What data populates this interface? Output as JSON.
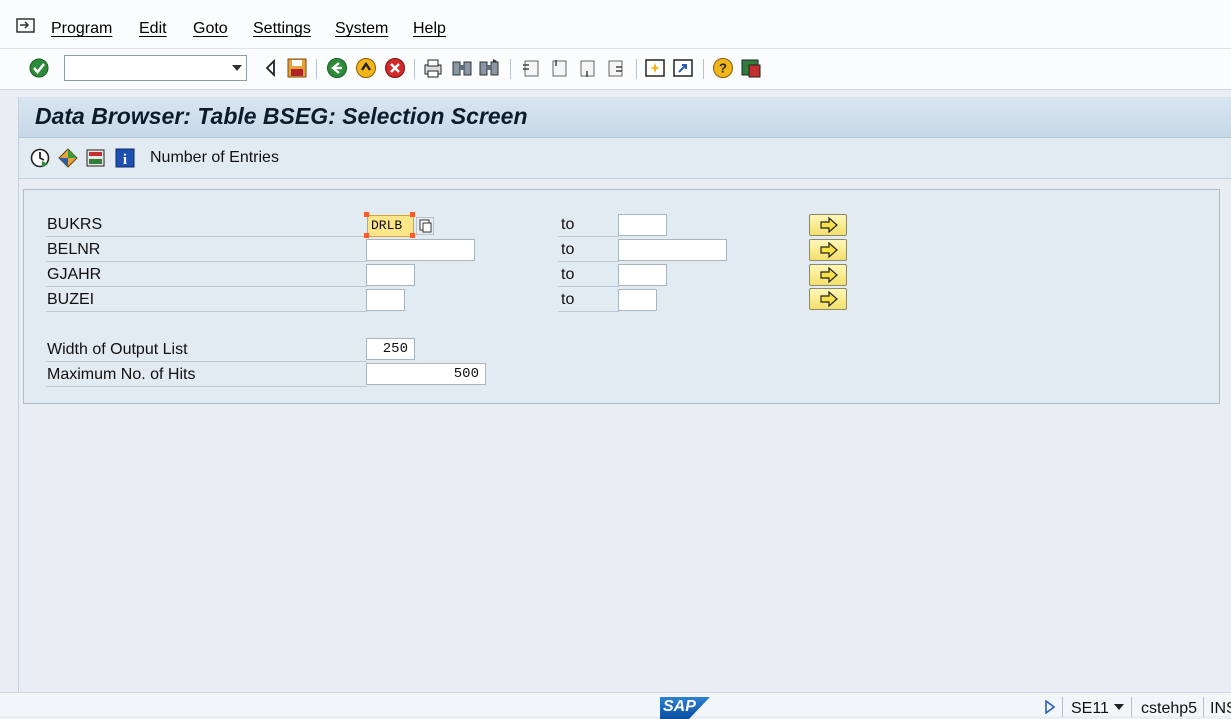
{
  "menubar": {
    "items": [
      "Program",
      "Edit",
      "Goto",
      "Settings",
      "System",
      "Help"
    ]
  },
  "toolbar": {
    "command_field_value": "",
    "icons": [
      "enter-check-icon",
      "command-dropdown-icon",
      "collapse-arrow-icon",
      "save-icon",
      "back-icon",
      "exit-icon",
      "cancel-icon",
      "print-icon",
      "find-icon",
      "find-next-icon",
      "first-page-icon",
      "previous-page-icon",
      "next-page-icon",
      "last-page-icon",
      "new-session-icon",
      "shortcut-icon",
      "help-icon",
      "customize-layout-icon"
    ]
  },
  "title": "Data Browser: Table BSEG: Selection Screen",
  "app_toolbar": {
    "icons": [
      "execute-icon",
      "selection-options-icon",
      "save-variant-icon",
      "info-icon"
    ],
    "number_of_entries_label": "Number of Entries"
  },
  "selection": {
    "rows": [
      {
        "label": "BUKRS",
        "from": "DRLB",
        "to_label": "to",
        "to": ""
      },
      {
        "label": "BELNR",
        "from": "",
        "to_label": "to",
        "to": ""
      },
      {
        "label": "GJAHR",
        "from": "",
        "to_label": "to",
        "to": ""
      },
      {
        "label": "BUZEI",
        "from": "",
        "to_label": "to",
        "to": ""
      }
    ],
    "width_label": "Width of Output List",
    "width_value": "250",
    "max_hits_label": "Maximum No. of Hits",
    "max_hits_value": "500"
  },
  "statusbar": {
    "logo": "SAP",
    "transaction": "SE11",
    "server": "cstehp5",
    "mode": "INS"
  },
  "colors": {
    "title_band": "#c7d8e6",
    "selected_field": "#fde58a",
    "multi_button": "#f4df6b",
    "sap_blue": "#0b4e9e"
  }
}
